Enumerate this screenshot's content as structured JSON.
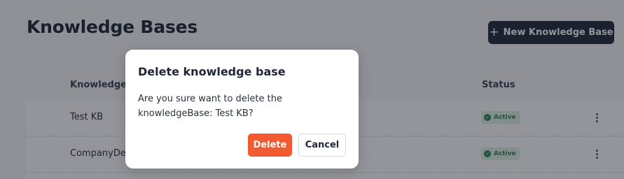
{
  "page": {
    "title": "Knowledge Bases",
    "new_button_label": "New Knowledge Base",
    "new_button_icon": "plus-icon"
  },
  "table": {
    "columns": [
      "Knowledge Base",
      "Status"
    ],
    "rows": [
      {
        "name": "Test KB",
        "status": "Active"
      },
      {
        "name": "CompanyDe",
        "status": "Active"
      }
    ],
    "row_actions_icon": "kebab-menu-icon",
    "status_icon": "check-circle-icon"
  },
  "modal": {
    "title": "Delete knowledge base",
    "message": "Are you sure want to delete the knowledgeBase: Test KB?",
    "delete_label": "Delete",
    "cancel_label": "Cancel"
  },
  "colors": {
    "primary_dark": "#222a38",
    "danger": "#f25a32",
    "status_active_bg": "#dff3e6",
    "status_active_text": "#2c8a4c"
  }
}
